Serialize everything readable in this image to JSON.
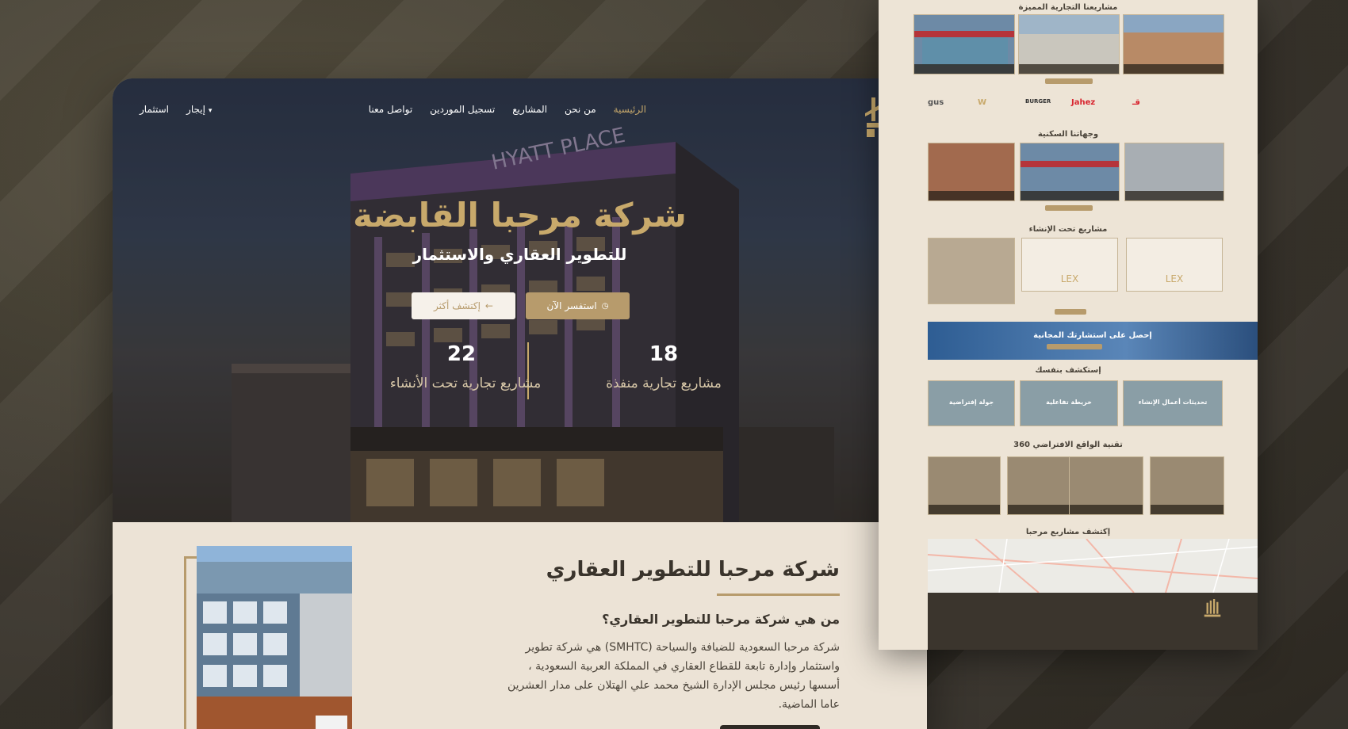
{
  "nav": {
    "logo_alt": "مرحبا",
    "links": [
      "الرئيسية",
      "من نحن",
      "المشاريع",
      "تسجيل الموردين",
      "تواصل معنا"
    ],
    "left_items": [
      "إيجار",
      "استثمار"
    ]
  },
  "hero": {
    "title": "شركة مرحبا القابضة",
    "subtitle": "للتطوير العقاري والاستثمار",
    "primary_button": "استفسر الآن",
    "secondary_button": "إكتشف أكثر",
    "stats": [
      {
        "value": "18",
        "label": "مشاريع تجارية منفذة"
      },
      {
        "value": "22",
        "label": "مشاريع تجارية تحت الأنشاء"
      }
    ],
    "building_sign": "HYATT PLACE"
  },
  "about": {
    "title": "شركة مرحبا للتطوير العقاري",
    "question": "من هي شركة مرحبا للتطوير العقاري؟",
    "text": "شركة مرحبا السعودية للضيافة والسياحة (SMHTC) هي شركة تطوير واستثمار وإدارة تابعة للقطاع العقاري في المملكة العربية السعودية ، أسسها رئيس مجلس الإدارة الشيخ محمد علي الهتلان على مدار العشرين عاما الماضية."
  },
  "side_page": {
    "sections": {
      "featured": "مشاريعنا التجارية المميزة",
      "residential": "وجهاتنا السكنية",
      "under_construction": "مشاريع تحت الإنشاء",
      "consult": "إحصل على استشارتك المجانية",
      "explore": "إستكشف بنفسك",
      "vr": "تقنية الواقع الافتراضي 360",
      "discover": "إكتشف مشاريع مرحبا"
    },
    "brands": [
      "Jahez",
      "BURGER",
      "W",
      "gus"
    ],
    "explore_cards": [
      "تحديثات أعمال الإنشاء",
      "خريطة تفاعلية",
      "جولة إفتراضية"
    ],
    "lex_label": "LEX"
  },
  "colors": {
    "gold": "#c8a96b",
    "beige": "#ece3d6",
    "dark": "#3a342c",
    "jahez_red": "#d8252f"
  }
}
